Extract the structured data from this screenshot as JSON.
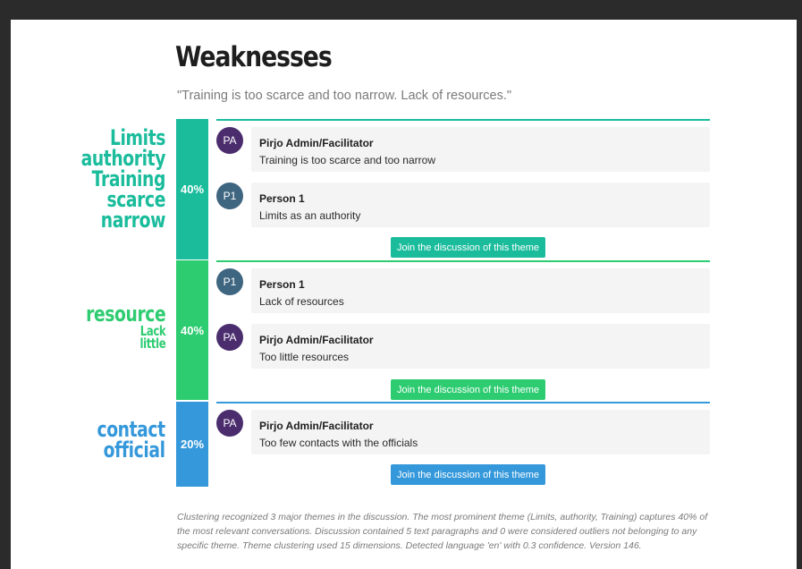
{
  "page": {
    "title": "Weaknesses",
    "quote": "\"Training is too scarce and too narrow. Lack of resources.\""
  },
  "themes": [
    {
      "color": "#1abc9c",
      "words": [
        "Limits",
        "authority",
        "Training",
        "scarce",
        "narrow"
      ],
      "percent": 40,
      "percent_label": "40%",
      "comments": [
        {
          "initials": "PA",
          "avatar_color": "#4b2d6e",
          "author": "Pirjo Admin/Facilitator",
          "text": "Training is too scarce and too narrow"
        },
        {
          "initials": "P1",
          "avatar_color": "#3f6680",
          "author": "Person 1",
          "text": "Limits as an authority"
        }
      ],
      "join_label": "Join the discussion of this theme"
    },
    {
      "color": "#2ecc71",
      "words": [
        "resource",
        "Lack",
        "little"
      ],
      "percent": 40,
      "percent_label": "40%",
      "comments": [
        {
          "initials": "P1",
          "avatar_color": "#3f6680",
          "author": "Person 1",
          "text": "Lack of resources"
        },
        {
          "initials": "PA",
          "avatar_color": "#4b2d6e",
          "author": "Pirjo Admin/Facilitator",
          "text": "Too little resources"
        }
      ],
      "join_label": "Join the discussion of this theme"
    },
    {
      "color": "#3498db",
      "words": [
        "contact",
        "official"
      ],
      "percent": 20,
      "percent_label": "20%",
      "comments": [
        {
          "initials": "PA",
          "avatar_color": "#4b2d6e",
          "author": "Pirjo Admin/Facilitator",
          "text": "Too few contacts with the officials"
        }
      ],
      "join_label": "Join the discussion of this theme"
    }
  ],
  "footer": "Clustering recognized 3 major themes in the discussion. The most prominent theme (Limits, authority, Training) captures 40% of the most relevant conversations. Discussion contained 5 text paragraphs and 0 were considered outliers not belonging to any specific theme. Theme clustering used 15 dimensions. Detected language 'en' with 0.3 confidence. Version 146."
}
